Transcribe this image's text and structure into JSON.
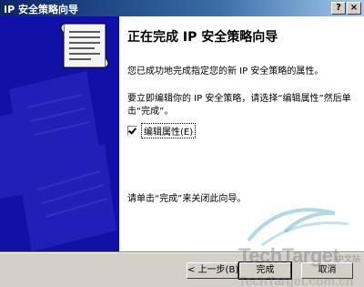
{
  "window": {
    "title": "IP 安全策略向导",
    "help_button": "?",
    "close_button": "×"
  },
  "banner": {
    "background_color": "#1111a8",
    "icon": "scroll-icon"
  },
  "content": {
    "heading": "正在完成 IP 安全策略向导",
    "paragraph1": "您已成功地完成指定您的新 IP 安全策略的属性。",
    "paragraph2": "要立即编辑你的 IP 安全策略，请选择“编辑属性”然后单击“完成”。",
    "checkbox_label": "编辑属性(E)",
    "checkbox_checked": true,
    "paragraph3": "请单击“完成”来关闭此向导。"
  },
  "buttons": {
    "back": "< 上一步(B)",
    "finish": "完成",
    "cancel": "取消"
  },
  "watermark": {
    "brand": "TechTarget",
    "cn_label": "中文站",
    "url": "TechTarget.com.cn"
  }
}
